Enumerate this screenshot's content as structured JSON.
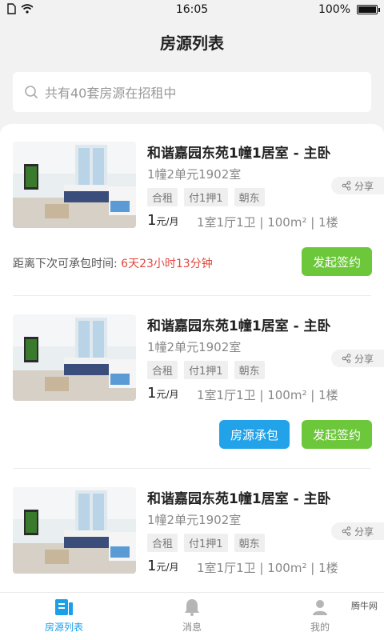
{
  "status": {
    "time": "16:05",
    "battery": "100%"
  },
  "page": {
    "title": "房源列表"
  },
  "search": {
    "placeholder": "共有40套房源在招租中"
  },
  "listings": [
    {
      "title": "和谐嘉园东苑1幢1居室 - 主卧",
      "address": "1幢2单元1902室",
      "tags": [
        "合租",
        "付1押1",
        "朝东"
      ],
      "share": "分享",
      "price": "1",
      "price_unit": "元/月",
      "meta": "1室1厅1卫 | 100m² | 1楼",
      "countdown_label": "距离下次可承包时间:",
      "countdown_value": "6天23小时13分钟",
      "buttons": [
        "发起签约"
      ]
    },
    {
      "title": "和谐嘉园东苑1幢1居室 - 主卧",
      "address": "1幢2单元1902室",
      "tags": [
        "合租",
        "付1押1",
        "朝东"
      ],
      "share": "分享",
      "price": "1",
      "price_unit": "元/月",
      "meta": "1室1厅1卫 | 100m² | 1楼",
      "buttons": [
        "房源承包",
        "发起签约"
      ]
    },
    {
      "title": "和谐嘉园东苑1幢1居室 - 主卧",
      "address": "1幢2单元1902室",
      "tags": [
        "合租",
        "付1押1",
        "朝东"
      ],
      "share": "分享",
      "price": "1",
      "price_unit": "元/月",
      "meta": "1室1厅1卫 | 100m² | 1楼"
    }
  ],
  "tabbar": {
    "items": [
      {
        "label": "房源列表",
        "icon": "house-list-icon",
        "active": true
      },
      {
        "label": "消息",
        "icon": "bell-icon",
        "active": false
      },
      {
        "label": "我的",
        "icon": "user-icon",
        "active": false
      }
    ],
    "watermark": "腾牛网"
  },
  "colors": {
    "primary_blue": "#22a2e8",
    "green": "#6cc73a",
    "countdown_red": "#e2453c",
    "tab_active": "#1a9fe8"
  }
}
